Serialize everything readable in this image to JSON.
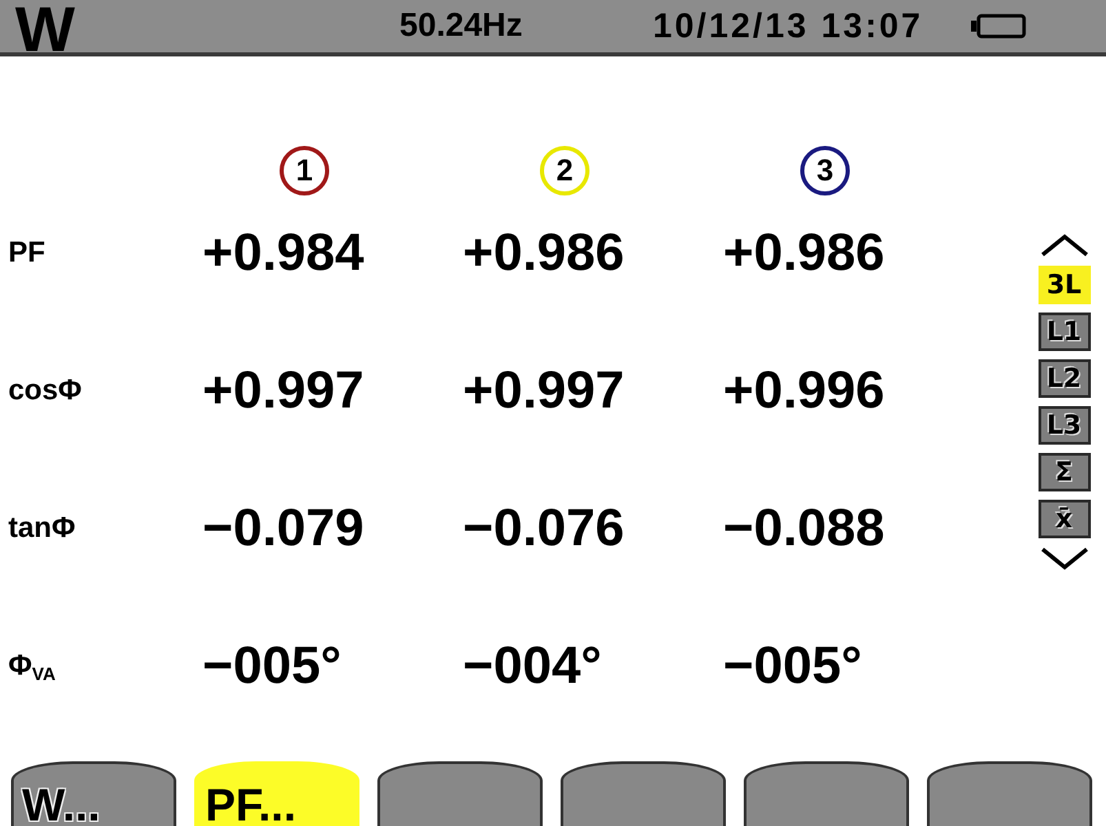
{
  "status_bar": {
    "mode": "W",
    "frequency": "50.24Hz",
    "datetime": "10/12/13 13:07"
  },
  "phases": [
    {
      "label": "1",
      "color": "#a01818"
    },
    {
      "label": "2",
      "color": "#e8e800"
    },
    {
      "label": "3",
      "color": "#1a1a80"
    }
  ],
  "rows": [
    {
      "label": "PF",
      "values": [
        "+0.984",
        "+0.986",
        "+0.986"
      ]
    },
    {
      "label": "cosΦ",
      "values": [
        "+0.997",
        "+0.997",
        "+0.996"
      ]
    },
    {
      "label": "tanΦ",
      "values": [
        "−0.079",
        "−0.076",
        "−0.088"
      ]
    },
    {
      "label": "Φ$_{VA}$",
      "values": [
        "−005°",
        "−004°",
        "−005°"
      ]
    }
  ],
  "selector": [
    {
      "label": "3L",
      "selected": true
    },
    {
      "label": "L1",
      "selected": false
    },
    {
      "label": "L2",
      "selected": false
    },
    {
      "label": "L3",
      "selected": false
    },
    {
      "label": "Σ",
      "selected": false
    },
    {
      "label": "x̄",
      "selected": false
    }
  ],
  "softkeys": [
    {
      "label": "W...",
      "selected": false
    },
    {
      "label": "PF...",
      "selected": true
    },
    {
      "selected": false
    },
    {
      "selected": false
    },
    {
      "selected": false
    },
    {
      "selected": false
    }
  ]
}
